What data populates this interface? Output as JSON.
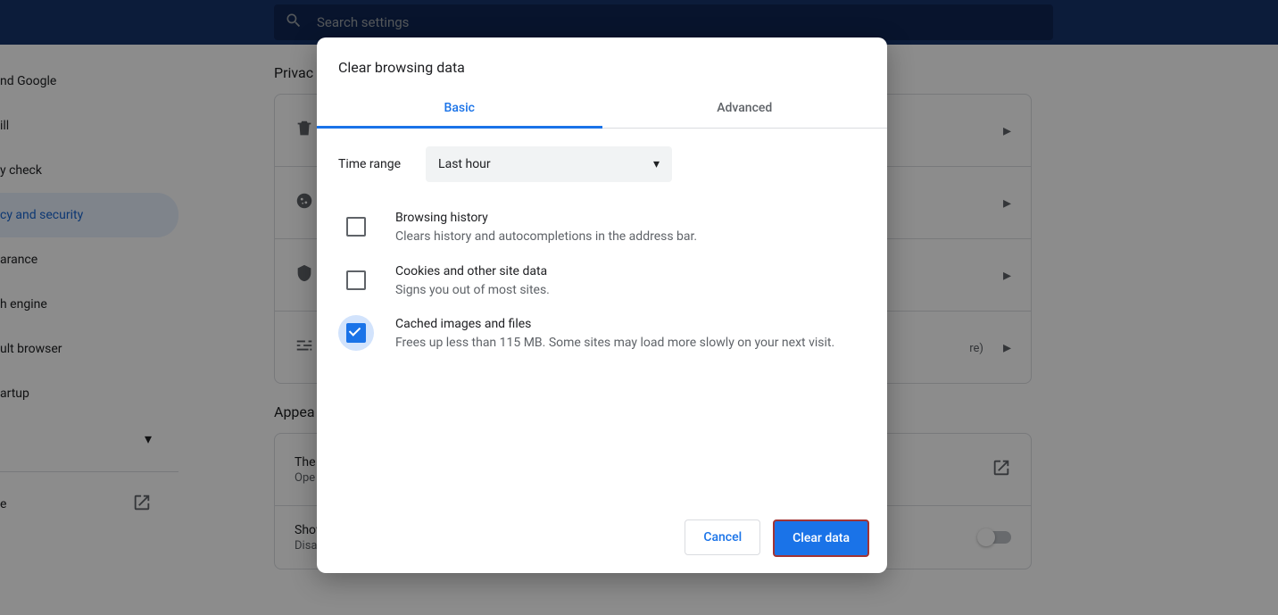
{
  "header": {
    "search_placeholder": "Search settings"
  },
  "sidebar": {
    "items": [
      {
        "label": "nd Google"
      },
      {
        "label": "ill"
      },
      {
        "label": "y check"
      },
      {
        "label": "cy and security"
      },
      {
        "label": "arance"
      },
      {
        "label": "h engine"
      },
      {
        "label": "ult browser"
      },
      {
        "label": "artup"
      }
    ],
    "extensions_label": "e"
  },
  "sections": {
    "privacy": {
      "title": "Privac",
      "rows": [
        {
          "title": "",
          "sub": ""
        },
        {
          "title": "",
          "sub": ""
        },
        {
          "title": "",
          "sub": ""
        },
        {
          "title": "",
          "sub": "re)"
        }
      ]
    },
    "appearance": {
      "title": "Appea",
      "theme_title": "The",
      "theme_sub": "Ope",
      "home_title": "Show home button",
      "home_sub": "Disabled"
    }
  },
  "dialog": {
    "title": "Clear browsing data",
    "tabs": {
      "basic": "Basic",
      "advanced": "Advanced"
    },
    "time_range_label": "Time range",
    "time_range_value": "Last hour",
    "options": [
      {
        "title": "Browsing history",
        "sub": "Clears history and autocompletions in the address bar.",
        "checked": false
      },
      {
        "title": "Cookies and other site data",
        "sub": "Signs you out of most sites.",
        "checked": false
      },
      {
        "title": "Cached images and files",
        "sub": "Frees up less than 115 MB. Some sites may load more slowly on your next visit.",
        "checked": true
      }
    ],
    "buttons": {
      "cancel": "Cancel",
      "clear": "Clear data"
    }
  }
}
